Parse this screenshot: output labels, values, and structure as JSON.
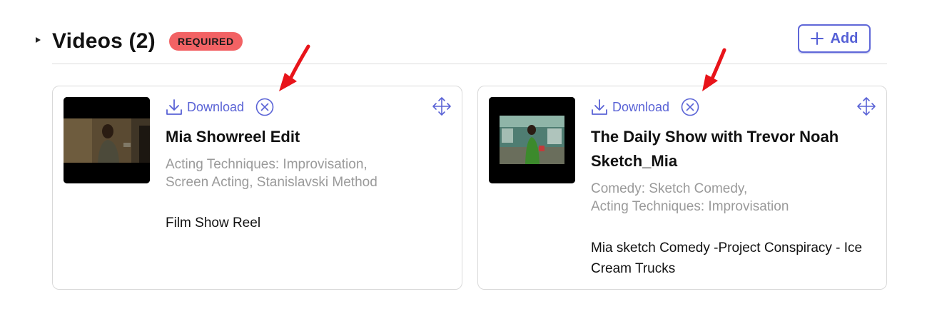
{
  "section": {
    "title": "Videos (2)",
    "badge": "REQUIRED",
    "add_label": "Add"
  },
  "videos": [
    {
      "download_label": "Download",
      "title": "Mia Showreel Edit",
      "tags_line1": "Acting Techniques: Improvisation,",
      "tags_line2": "Screen Acting, Stanislavski Method",
      "description": "Film Show Reel"
    },
    {
      "download_label": "Download",
      "title": "The Daily Show with Trevor Noah Sketch_Mia",
      "tags_line1": "Comedy: Sketch Comedy,",
      "tags_line2": "Acting Techniques: Improvisation",
      "description": "Mia sketch Comedy -Project Conspiracy - Ice Cream Trucks"
    }
  ],
  "icons": {
    "toggle": "caret-right-icon",
    "add": "plus-icon",
    "download": "download-icon",
    "remove": "close-circle-icon",
    "drag": "move-icon",
    "annotation": "red-arrow-icon"
  },
  "colors": {
    "accent": "#5a63d6",
    "badge_bg": "#f26264",
    "annotation": "#e8141a",
    "tag_text": "#9a9a9a"
  }
}
